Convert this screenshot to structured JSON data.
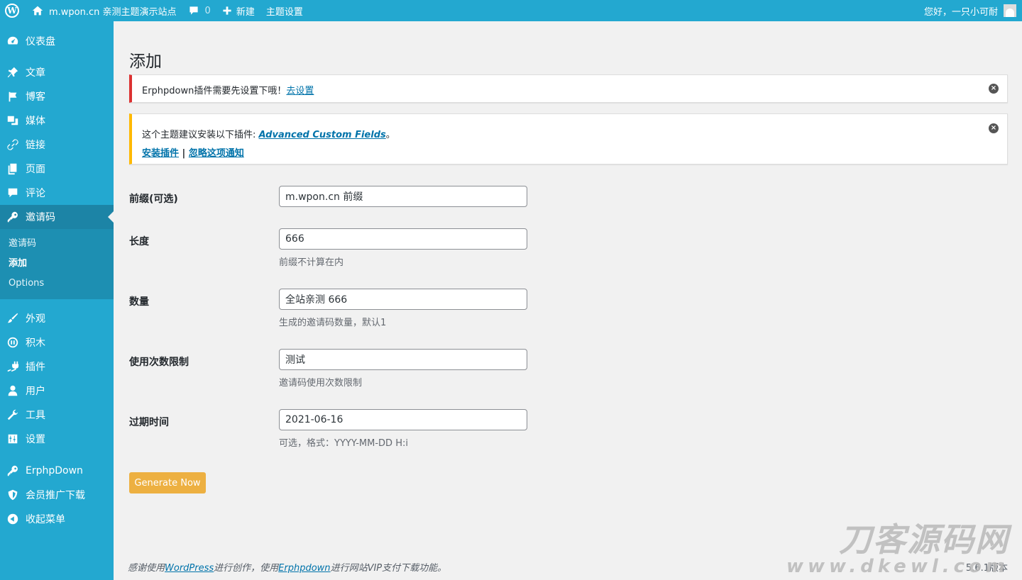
{
  "adminbar": {
    "site_name": "m.wpon.cn 亲测主题演示站点",
    "comments_count": "0",
    "new_label": "新建",
    "theme_settings": "主题设置",
    "greeting": "您好，一只小可耐"
  },
  "sidebar": {
    "items": [
      {
        "label": "仪表盘",
        "icon": "dashboard-icon"
      },
      {
        "label": "文章",
        "icon": "pin-icon"
      },
      {
        "label": "博客",
        "icon": "flag-icon"
      },
      {
        "label": "媒体",
        "icon": "media-icon"
      },
      {
        "label": "链接",
        "icon": "link-icon"
      },
      {
        "label": "页面",
        "icon": "page-icon"
      },
      {
        "label": "评论",
        "icon": "comment-icon"
      },
      {
        "label": "邀请码",
        "icon": "key-icon"
      },
      {
        "label": "外观",
        "icon": "brush-icon"
      },
      {
        "label": "积木",
        "icon": "blocks-icon"
      },
      {
        "label": "插件",
        "icon": "plugin-icon"
      },
      {
        "label": "用户",
        "icon": "user-icon"
      },
      {
        "label": "工具",
        "icon": "wrench-icon"
      },
      {
        "label": "设置",
        "icon": "settings-icon"
      },
      {
        "label": "ErphpDown",
        "icon": "key-icon"
      },
      {
        "label": "会员推广下载",
        "icon": "shield-icon"
      },
      {
        "label": "收起菜单",
        "icon": "collapse-icon"
      }
    ],
    "submenu": [
      "邀请码",
      "添加",
      "Options"
    ]
  },
  "page": {
    "title": "添加"
  },
  "notices": {
    "error_text": "Erphpdown插件需要先设置下哦！",
    "error_link": "去设置",
    "warning_text": "这个主题建议安装以下插件: ",
    "warning_plugin": "Advanced Custom Fields",
    "warning_period": "。",
    "install_link": "安装插件",
    "separator": " | ",
    "dismiss_link": "忽略这项通知"
  },
  "form": {
    "prefix_label": "前缀(可选)",
    "prefix_value": "m.wpon.cn 前缀",
    "length_label": "长度",
    "length_value": "666",
    "length_desc": "前缀不计算在内",
    "count_label": "数量",
    "count_value": "全站亲测 666",
    "count_desc": "生成的邀请码数量，默认1",
    "limit_label": "使用次数限制",
    "limit_value": "测试",
    "limit_desc": "邀请码使用次数限制",
    "expire_label": "过期时间",
    "expire_value": "2021-06-16",
    "expire_desc": "可选，格式：YYYY-MM-DD H:i",
    "submit": "Generate Now"
  },
  "footer": {
    "prefix": "感谢使用",
    "wp_link": "WordPress",
    "middle": "进行创作，使用",
    "erphp_link": "Erphpdown",
    "suffix": "进行网站VIP支付下载功能。",
    "version": "5.6.1版本"
  },
  "watermark": {
    "line1": "刀客源码网",
    "line2": "www.dkewl.com"
  }
}
